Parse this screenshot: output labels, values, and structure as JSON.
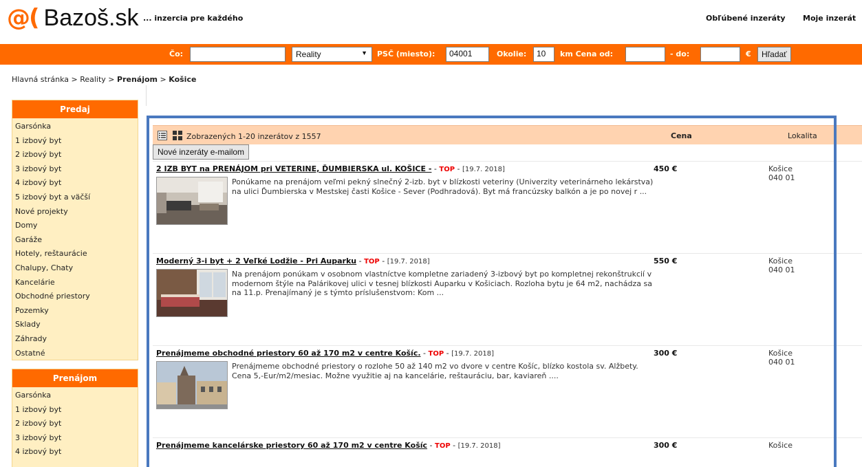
{
  "header": {
    "logo_at": "@(",
    "logo_name": "Bazoš.sk",
    "tagline": "... inzercia pre každého",
    "nav": [
      "Obľúbené inzeráty",
      "Moje inzerát"
    ]
  },
  "search": {
    "co_label": "Čo:",
    "co_value": "",
    "category_selected": "Reality",
    "psc_label": "PSČ (miesto):",
    "psc_value": "04001",
    "okolie_label": "Okolie:",
    "okolie_value": "10",
    "km_cena_label": "km Cena od:",
    "cena_od_value": "",
    "do_label": "- do:",
    "cena_do_value": "",
    "currency": "€",
    "search_button": "Hľadať"
  },
  "breadcrumb": {
    "home": "Hlavná stránka",
    "sep": ">",
    "reality": "Reality",
    "prenajom": "Prenájom",
    "kosice": "Košice"
  },
  "sidebar": {
    "predaj_title": "Predaj",
    "predaj_items": [
      "Garsónka",
      "1 izbový byt",
      "2 izbový byt",
      "3 izbový byt",
      "4 izbový byt",
      "5 izbový byt a väčší",
      "Nové projekty",
      "Domy",
      "Garáže",
      "Hotely, reštaurácie",
      "Chalupy, Chaty",
      "Kancelárie",
      "Obchodné priestory",
      "Pozemky",
      "Sklady",
      "Záhrady",
      "Ostatné"
    ],
    "prenajom_title": "Prenájom",
    "prenajom_items": [
      "Garsónka",
      "1 izbový byt",
      "2 izbový byt",
      "3 izbový byt",
      "4 izbový byt"
    ]
  },
  "results": {
    "count_text": "Zobrazených 1-20 inzerátov z 1557",
    "price_header": "Cena",
    "location_header": "Lokalita",
    "email_button": "Nové inzeráty e-mailom",
    "ads": [
      {
        "title": "2 IZB BYT na PRENÁJOM pri VETERINE, ĎUMBIERSKA ul. KOŠICE -",
        "top": "TOP",
        "date": "[19.7. 2018]",
        "description": "Ponúkame na prenájom veľmi pekný slnečný 2-izb. byt v blízkosti veteriny (Univerzity veterinárneho lekárstva) na ulici Ďumbierska v Mestskej časti Košice - Sever (Podhradová). Byt má francúzsky balkón a je po novej r ...",
        "price": "450 €",
        "city": "Košice",
        "psc": "040 01"
      },
      {
        "title": "Moderný 3-i byt + 2 Veľké Lodžie - Pri Auparku",
        "top": "TOP",
        "date": "[19.7. 2018]",
        "description": "Na prenájom ponúkam v osobnom vlastníctve kompletne zariadený 3-izbový byt po kompletnej rekonštrukcií v modernom štýle na Palárikovej ulici v tesnej blízkosti Auparku v Košiciach. Rozloha bytu je 64 m2, nachádza sa na 11.p. Prenajímaný je s týmto príslušenstvom: Kom ...",
        "price": "550 €",
        "city": "Košice",
        "psc": "040 01"
      },
      {
        "title": "Prenájmeme obchodné priestory 60 až 170 m2 v centre Košíc.",
        "top": "TOP",
        "date": "[19.7. 2018]",
        "description": "Prenájmeme obchodné priestory o rozlohe 50 až 140 m2 vo dvore v centre Košíc, blízko kostola sv. Alžbety. Cena 5,-Eur/m2/mesiac. Možne využitie aj na kancelárie, reštauráciu, bar, kaviareň ....",
        "price": "300 €",
        "city": "Košice",
        "psc": "040 01"
      },
      {
        "title": "Prenájmeme kancelárske priestory 60 až 170 m2 v centre Košíc",
        "top": "TOP",
        "date": "[19.7. 2018]",
        "description": "",
        "price": "300 €",
        "city": "Košice",
        "psc": ""
      }
    ]
  }
}
